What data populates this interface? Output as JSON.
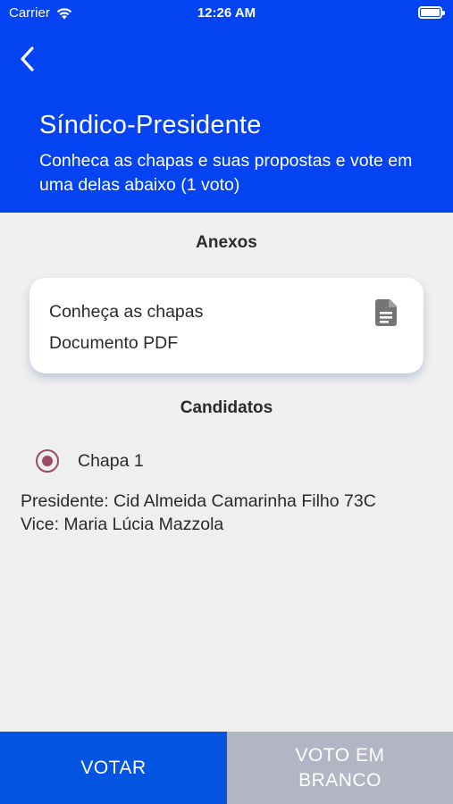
{
  "status_bar": {
    "carrier": "Carrier",
    "time": "12:26 AM",
    "wifi_icon": "wifi-icon",
    "battery_icon": "battery-icon"
  },
  "header": {
    "back_icon": "chevron-left-icon",
    "title": "Síndico-Presidente",
    "subtitle": "Conheca as chapas e suas propostas e vote em uma delas abaixo (1 voto)",
    "background_color": "#0443f2"
  },
  "attachments": {
    "section_title": "Anexos",
    "items": [
      {
        "title": "Conheça as chapas",
        "subtitle": "Documento PDF",
        "icon": "document-icon"
      }
    ]
  },
  "candidates": {
    "section_title": "Candidatos",
    "options": [
      {
        "label": "Chapa 1",
        "selected": true,
        "president": "Presidente: Cid Almeida Camarinha Filho 73C",
        "vice": "Vice: Maria Lúcia Mazzola"
      }
    ],
    "radio_color": "#9b4b6a"
  },
  "actions": {
    "vote_label": "VOTAR",
    "blank_vote_label": "VOTO EM BRANCO",
    "vote_color": "#0454e2",
    "blank_vote_color": "#b1b5c4"
  }
}
